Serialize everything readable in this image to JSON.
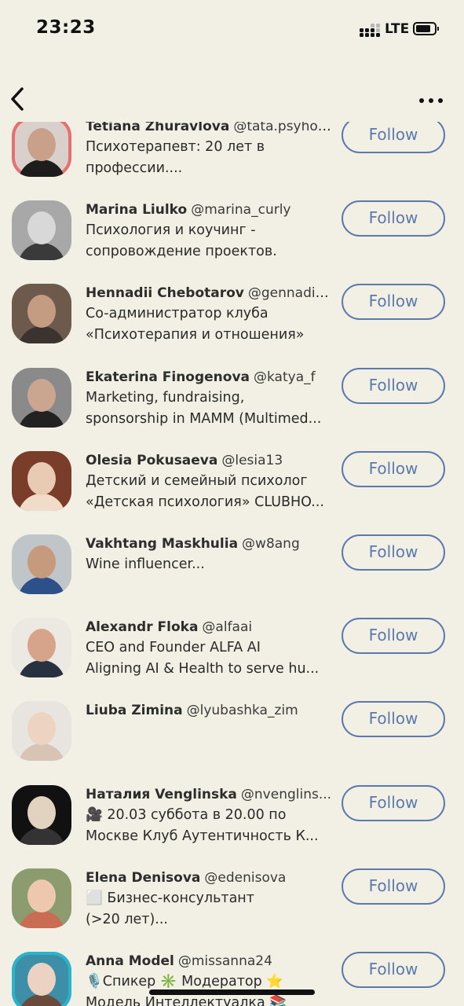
{
  "status_bar": {
    "time": "23:23",
    "network": "LTE"
  },
  "follow_label": "Follow",
  "users": [
    {
      "name": "Tetiana Zhuravlova",
      "handle": "@tata.psyhol...",
      "bio": [
        "Психотерапевт: 20 лет в",
        "профессии...."
      ],
      "avatar": {
        "bg": "#d9d0cc",
        "skin": "#c9a08a",
        "cloth": "#1d1d1d",
        "ring": "#e76f6f"
      }
    },
    {
      "name": "Marina Liulko",
      "handle": "@marina_curly",
      "bio": [
        "Психология и коучинг -",
        "сопровождение проектов."
      ],
      "avatar": {
        "bg": "#a8a8a8",
        "skin": "#d8d8d8",
        "cloth": "#3a3a3a",
        "ring": ""
      }
    },
    {
      "name": "Hennadii Chebotarov",
      "handle": "@gennadiy...",
      "bio": [
        "Co-администратор клуба",
        "«Психотерапия и отношения»"
      ],
      "avatar": {
        "bg": "#6e5a4c",
        "skin": "#c49c82",
        "cloth": "#3b3330",
        "ring": ""
      }
    },
    {
      "name": "Ekaterina Finogenova",
      "handle": "@katya_f",
      "bio": [
        "Marketing, fundraising,",
        "sponsorship in MAMM (Multimed..."
      ],
      "avatar": {
        "bg": "#8a8a8a",
        "skin": "#caa58f",
        "cloth": "#222222",
        "ring": ""
      }
    },
    {
      "name": "Olesia Pokusaeva",
      "handle": "@lesia13",
      "bio": [
        "Детский и семейный психолог",
        "«Детская психология» CLUBHO..."
      ],
      "avatar": {
        "bg": "#7a3d2a",
        "skin": "#e9cbb4",
        "cloth": "#f0dcc8",
        "ring": ""
      }
    },
    {
      "name": "Vakhtang Maskhulia",
      "handle": "@w8ang",
      "bio": [
        "Wine influencer..."
      ],
      "avatar": {
        "bg": "#bfc5c8",
        "skin": "#c69a7c",
        "cloth": "#2d4f8a",
        "ring": ""
      }
    },
    {
      "name": "Alexandr Floka",
      "handle": "@alfaai",
      "bio": [
        "CEO and Founder ALFA AI",
        "Aligning AI & Health to serve hu..."
      ],
      "avatar": {
        "bg": "#ece8e2",
        "skin": "#d6a48a",
        "cloth": "#27313f",
        "ring": ""
      }
    },
    {
      "name": "Liuba Zimina",
      "handle": "@lyubashka_zim",
      "bio": [],
      "avatar": {
        "bg": "#e8e4df",
        "skin": "#edd3c2",
        "cloth": "#d8c4b4",
        "ring": ""
      }
    },
    {
      "name": "Наталия Venglinska",
      "handle": "@nvenglins...",
      "bio": [
        "🎥 20.03 суббота в 20.00 по",
        "Москве Клуб Аутентичность К..."
      ],
      "avatar": {
        "bg": "#111111",
        "skin": "#e2d2c0",
        "cloth": "#333333",
        "ring": ""
      }
    },
    {
      "name": "Elena Denisova",
      "handle": "@edenisova",
      "bio": [
        "⬜ Бизнес-консультант",
        "(>20 лет)..."
      ],
      "avatar": {
        "bg": "#8c9c6e",
        "skin": "#edc8ae",
        "cloth": "#c96c54",
        "ring": ""
      }
    },
    {
      "name": "Anna Model",
      "handle": "@missanna24",
      "bio": [
        "🎙️Спикер ✳️ Модератор ⭐",
        "Модель Интеллектуалка 📚"
      ],
      "avatar": {
        "bg": "#3d8fa8",
        "skin": "#ecd2c2",
        "cloth": "#6b4a3e",
        "ring": "#2bb3c9"
      }
    }
  ]
}
